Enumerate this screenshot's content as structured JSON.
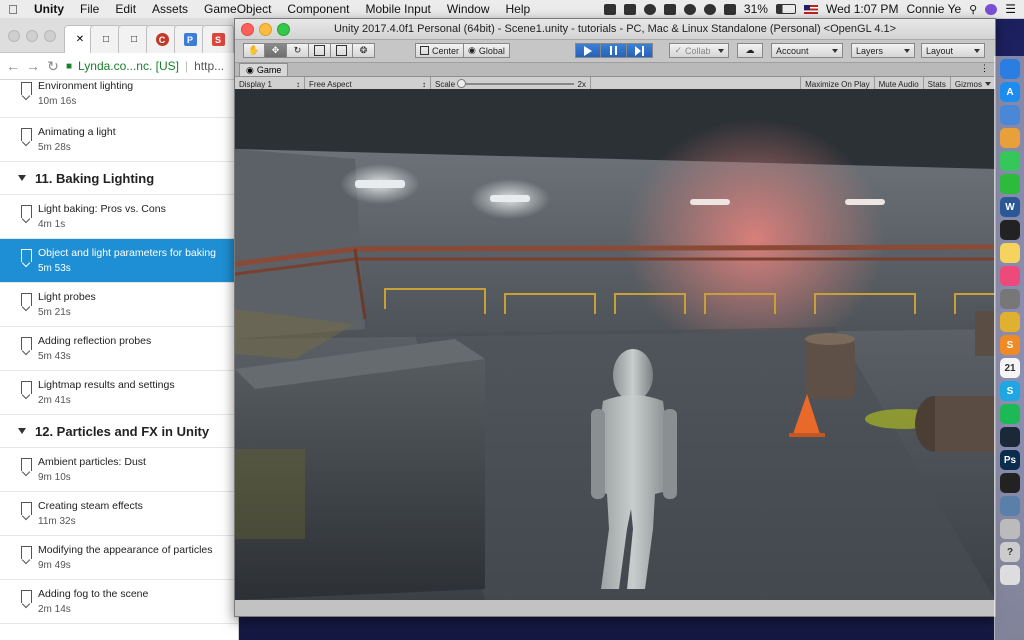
{
  "menubar": {
    "app": "Unity",
    "items": [
      "File",
      "Edit",
      "Assets",
      "GameObject",
      "Component",
      "Mobile Input",
      "Window",
      "Help"
    ],
    "battery": "31%",
    "clock": "Wed 1:07 PM",
    "user": "Connie Ye"
  },
  "chrome": {
    "address": "Lynda.co...nc. [US]",
    "address_rest": "http...",
    "tab_icons": [
      "page-icon",
      "page-icon",
      "page-icon",
      "circle-c-icon",
      "p-icon",
      "s-icon"
    ]
  },
  "course": [
    {
      "kind": "item",
      "title": "Environment lighting",
      "duration": "10m 16s"
    },
    {
      "kind": "item",
      "title": "Animating a light",
      "duration": "5m 28s"
    },
    {
      "kind": "chapter",
      "title": "11. Baking Lighting"
    },
    {
      "kind": "item",
      "title": "Light baking: Pros vs. Cons",
      "duration": "4m 1s"
    },
    {
      "kind": "item",
      "title": "Object and light parameters for baking",
      "duration": "5m 53s",
      "selected": true
    },
    {
      "kind": "item",
      "title": "Light probes",
      "duration": "5m 21s"
    },
    {
      "kind": "item",
      "title": "Adding reflection probes",
      "duration": "5m 43s"
    },
    {
      "kind": "item",
      "title": "Lightmap results and settings",
      "duration": "2m 41s"
    },
    {
      "kind": "chapter",
      "title": "12. Particles and FX in Unity"
    },
    {
      "kind": "item",
      "title": "Ambient particles: Dust",
      "duration": "9m 10s"
    },
    {
      "kind": "item",
      "title": "Creating steam effects",
      "duration": "11m 32s"
    },
    {
      "kind": "item",
      "title": "Modifying the appearance of particles",
      "duration": "9m 49s"
    },
    {
      "kind": "item",
      "title": "Adding fog to the scene",
      "duration": "2m 14s"
    }
  ],
  "unity": {
    "title": "Unity 2017.4.0f1 Personal (64bit) - Scene1.unity - tutorials - PC, Mac & Linux Standalone (Personal) <OpenGL 4.1>",
    "pivot": "Center",
    "space": "Global",
    "collab": "Collab",
    "account": "Account",
    "layers": "Layers",
    "layout": "Layout",
    "game_tab": "Game",
    "display": "Display 1",
    "aspect": "Free Aspect",
    "scale_label": "Scale",
    "scale_value": "2x",
    "maximize": "Maximize On Play",
    "mute": "Mute Audio",
    "stats": "Stats",
    "gizmos": "Gizmos"
  },
  "dock": [
    {
      "name": "safari-icon",
      "color": "#2a7de1",
      "label": ""
    },
    {
      "name": "app-store-icon",
      "color": "#1d8cf0",
      "label": "A"
    },
    {
      "name": "xcode-icon",
      "color": "#4a88d6",
      "label": ""
    },
    {
      "name": "photos-icon",
      "color": "#e8a13a",
      "label": ""
    },
    {
      "name": "messages-icon",
      "color": "#35c759",
      "label": ""
    },
    {
      "name": "wechat-icon",
      "color": "#2dbb3b",
      "label": ""
    },
    {
      "name": "word-icon",
      "color": "#2b5797",
      "label": "W"
    },
    {
      "name": "terminal-icon",
      "color": "#222222",
      "label": ""
    },
    {
      "name": "notes-icon",
      "color": "#f4d35e",
      "label": ""
    },
    {
      "name": "itunes-icon",
      "color": "#ec4a7a",
      "label": ""
    },
    {
      "name": "preferences-icon",
      "color": "#777777",
      "label": ""
    },
    {
      "name": "chrome-icon",
      "color": "#e0b030",
      "label": ""
    },
    {
      "name": "sublime-icon",
      "color": "#f08a24",
      "label": "S"
    },
    {
      "name": "calendar-icon",
      "color": "#f5f5f5",
      "label": "21"
    },
    {
      "name": "skype-icon",
      "color": "#1fa7e4",
      "label": "S"
    },
    {
      "name": "spotify-icon",
      "color": "#1db954",
      "label": ""
    },
    {
      "name": "steam-icon",
      "color": "#1b2838",
      "label": ""
    },
    {
      "name": "photoshop-icon",
      "color": "#0a2d4d",
      "label": "Ps"
    },
    {
      "name": "unity-icon",
      "color": "#222222",
      "label": ""
    },
    {
      "name": "vpn-icon",
      "color": "#5a7fa8",
      "label": ""
    },
    {
      "name": "finder-icon",
      "color": "#bbbbbb",
      "label": ""
    },
    {
      "name": "help-icon",
      "color": "#cccccc",
      "label": "?"
    },
    {
      "name": "trash-icon",
      "color": "#dddddd",
      "label": ""
    }
  ]
}
